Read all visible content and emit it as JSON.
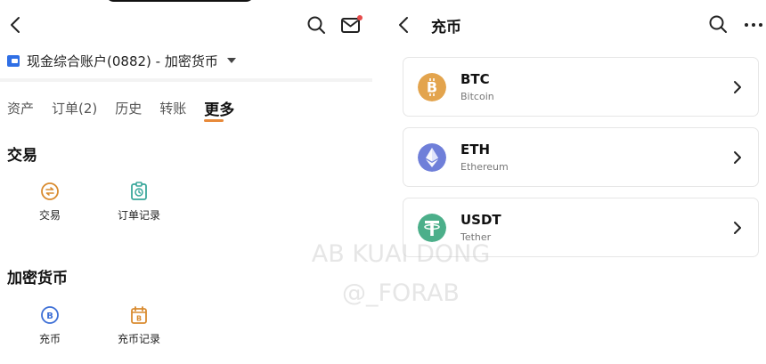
{
  "left": {
    "account_label": "现金综合账户(0882) - 加密货币",
    "tabs": [
      {
        "label": "资产"
      },
      {
        "label": "订单(2)"
      },
      {
        "label": "历史"
      },
      {
        "label": "转账"
      },
      {
        "label": "更多"
      }
    ],
    "active_tab": "更多",
    "sections": [
      {
        "title": "交易",
        "items": [
          {
            "label": "交易",
            "icon": "trade-icon"
          },
          {
            "label": "订单记录",
            "icon": "order-record-icon"
          }
        ]
      },
      {
        "title": "加密货币",
        "items": [
          {
            "label": "充币",
            "icon": "deposit-icon"
          },
          {
            "label": "充币记录",
            "icon": "deposit-record-icon"
          }
        ]
      }
    ]
  },
  "right": {
    "title": "充币",
    "coins": [
      {
        "symbol": "BTC",
        "name": "Bitcoin",
        "icon": "bitcoin-icon",
        "color": "#e3a44d"
      },
      {
        "symbol": "ETH",
        "name": "Ethereum",
        "icon": "ethereum-icon",
        "color": "#6f7fd9"
      },
      {
        "symbol": "USDT",
        "name": "Tether",
        "icon": "tether-icon",
        "color": "#4caf8a"
      }
    ]
  },
  "watermark": {
    "line1": "AB KUAI DONG",
    "line2": "@_FORAB"
  },
  "colors": {
    "accent": "#e88a3a",
    "icon_orange": "#d98b2f",
    "icon_teal": "#3aa79b",
    "icon_blue": "#3d6fd6",
    "account_blue": "#2f6fe5",
    "notification_dot": "#e64b4b"
  }
}
